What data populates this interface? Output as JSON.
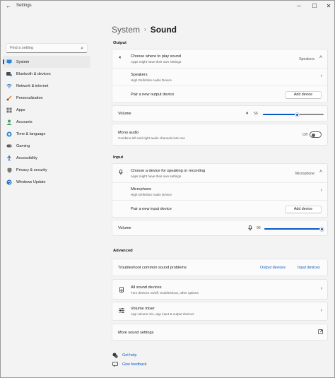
{
  "window": {
    "title": "Settings",
    "back_glyph": "←",
    "minimize_glyph": "─",
    "maximize_glyph": "☐",
    "close_glyph": "✕"
  },
  "search": {
    "placeholder": "Find a setting",
    "icon": "search-icon"
  },
  "sidebar": {
    "items": [
      {
        "label": "System",
        "icon": "monitor-icon",
        "active": true
      },
      {
        "label": "Bluetooth & devices",
        "icon": "bluetooth-icon"
      },
      {
        "label": "Network & internet",
        "icon": "wifi-icon"
      },
      {
        "label": "Personalization",
        "icon": "brush-icon"
      },
      {
        "label": "Apps",
        "icon": "apps-icon"
      },
      {
        "label": "Accounts",
        "icon": "person-icon"
      },
      {
        "label": "Time & language",
        "icon": "globe-icon"
      },
      {
        "label": "Gaming",
        "icon": "gamepad-icon"
      },
      {
        "label": "Accessibility",
        "icon": "accessibility-icon"
      },
      {
        "label": "Privacy & security",
        "icon": "shield-icon"
      },
      {
        "label": "Windows Update",
        "icon": "update-icon"
      }
    ]
  },
  "breadcrumb": {
    "parent": "System",
    "separator": "›",
    "current": "Sound"
  },
  "output": {
    "heading": "Output",
    "choose_title": "Choose where to play sound",
    "choose_sub": "Apps might have their own settings",
    "choose_value": "Speakers",
    "device_name": "Speakers",
    "device_sub": "High Definition Audio Device",
    "pair_label": "Pair a new output device",
    "add_button": "Add device",
    "volume_label": "Volume",
    "volume_value": "56",
    "volume_level": 56,
    "mono_title": "Mono audio",
    "mono_sub": "Combine left and right audio channels into one",
    "mono_state": "Off"
  },
  "input": {
    "heading": "Input",
    "choose_title": "Choose a device for speaking or recording",
    "choose_sub": "Apps might have their own settings",
    "choose_value": "Microphone",
    "device_name": "Microphone",
    "device_sub": "High Definition Audio Device",
    "pair_label": "Pair a new input device",
    "add_button": "Add device",
    "volume_label": "Volume",
    "volume_value": "96",
    "volume_level": 96
  },
  "advanced": {
    "heading": "Advanced",
    "troubleshoot_label": "Troubleshoot common sound problems",
    "output_devices_link": "Output devices",
    "input_devices_link": "Input devices",
    "all_devices_title": "All sound devices",
    "all_devices_sub": "Turn devices on/off, troubleshoot, other options",
    "mixer_title": "Volume mixer",
    "mixer_sub": "App volume mix, app input & output devices",
    "more_label": "More sound settings"
  },
  "footer": {
    "help_label": "Get help",
    "feedback_label": "Give feedback"
  },
  "colors": {
    "accent": "#0a5ac2",
    "background": "#f3f3f3",
    "card": "#fbfbfb"
  }
}
